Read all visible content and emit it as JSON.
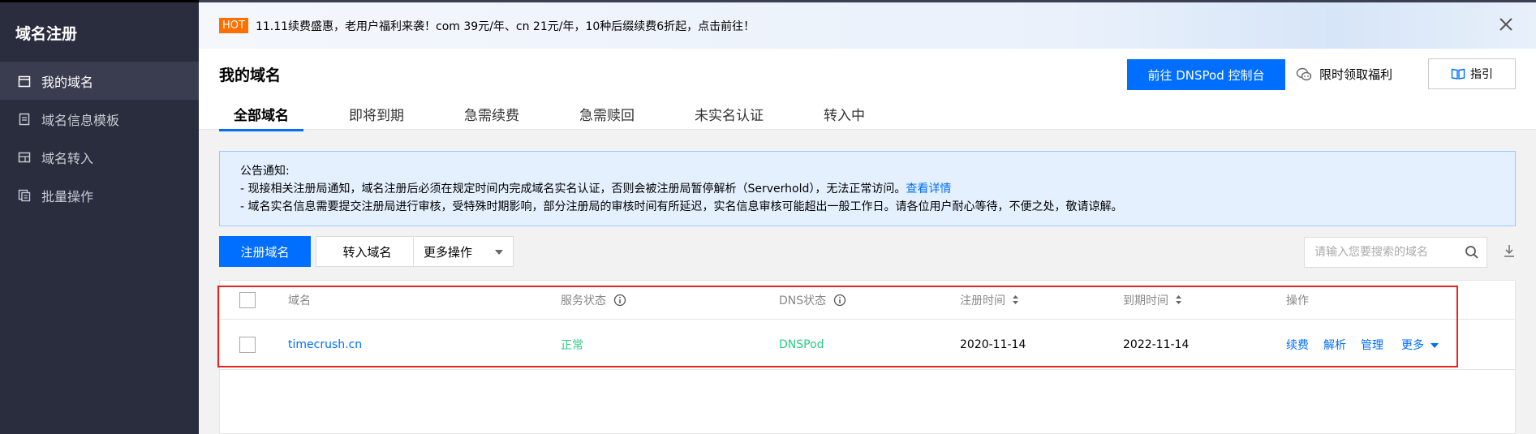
{
  "sidebar": {
    "title": "域名注册",
    "items": [
      {
        "label": "我的域名",
        "icon": "calendar-icon",
        "active": true
      },
      {
        "label": "域名信息模板",
        "icon": "document-icon",
        "active": false
      },
      {
        "label": "域名转入",
        "icon": "transfer-icon",
        "active": false
      },
      {
        "label": "批量操作",
        "icon": "copy-icon",
        "active": false
      }
    ]
  },
  "banner": {
    "badge": "HOT",
    "text": "11.11续费盛惠，老用户福利来袭！com 39元/年、cn 21元/年，10种后缀续费6折起，点击前往！",
    "close_icon": "close-icon"
  },
  "header": {
    "title": "我的域名",
    "dnspod_button": "前往 DNSPod 控制台",
    "benefit_link": "限时领取福利",
    "guide_button": "指引"
  },
  "tabs": [
    {
      "label": "全部域名",
      "active": true
    },
    {
      "label": "即将到期",
      "active": false
    },
    {
      "label": "急需续费",
      "active": false
    },
    {
      "label": "急需赎回",
      "active": false
    },
    {
      "label": "未实名认证",
      "active": false
    },
    {
      "label": "转入中",
      "active": false
    }
  ],
  "notice": {
    "title": "公告通知:",
    "line1": "- 现接相关注册局通知，域名注册后必须在规定时间内完成域名实名认证，否则会被注册局暂停解析（Serverhold），无法正常访问。",
    "line1_link": "查看详情",
    "line2": "- 域名实名信息需要提交注册局进行审核，受特殊时期影响，部分注册局的审核时间有所延迟，实名信息审核可能超出一般工作日。请各位用户耐心等待，不便之处，敬请谅解。"
  },
  "toolbar": {
    "register_button": "注册域名",
    "transfer_button": "转入域名",
    "more_select": "更多操作",
    "search_placeholder": "请输入您要搜索的域名"
  },
  "table": {
    "columns": {
      "domain": "域名",
      "service_status": "服务状态",
      "dns_status": "DNS状态",
      "register_time": "注册时间",
      "expire_time": "到期时间",
      "actions": "操作"
    },
    "rows": [
      {
        "domain": "timecrush.cn",
        "service_status": "正常",
        "dns_status": "DNSPod",
        "register_time": "2020-11-14",
        "expire_time": "2022-11-14",
        "actions": [
          "续费",
          "解析",
          "管理",
          "更多"
        ]
      }
    ]
  },
  "colors": {
    "primary": "#006eff",
    "sidebar_bg": "#292d3e",
    "status_green": "#29cc85",
    "hot_orange": "#ff6f00",
    "highlight_red": "#e8221c"
  }
}
